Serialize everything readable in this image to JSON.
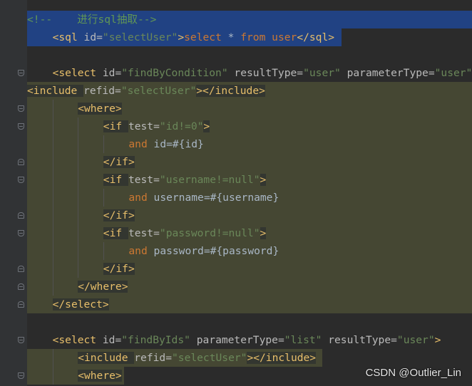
{
  "editor": {
    "lines": [
      {
        "tokens": [
          {
            "t": "<!--    进行sql抽取-->",
            "c": "com"
          }
        ]
      },
      {
        "tokens": [
          {
            "t": "<sql ",
            "c": "tag"
          },
          {
            "t": "id",
            "c": "attr"
          },
          {
            "t": "=",
            "c": "attr"
          },
          {
            "t": "\"selectUser\"",
            "c": "val"
          },
          {
            "t": ">",
            "c": "tag"
          },
          {
            "t": "select",
            "c": "kw"
          },
          {
            "t": " * ",
            "c": "txt"
          },
          {
            "t": "from",
            "c": "kw"
          },
          {
            "t": " ",
            "c": "txt"
          },
          {
            "t": "user",
            "c": "kw"
          },
          {
            "t": "</sql>",
            "c": "tag"
          }
        ]
      },
      {
        "tokens": []
      },
      {
        "tokens": [
          {
            "t": "<select ",
            "c": "tag"
          },
          {
            "t": "id",
            "c": "attr"
          },
          {
            "t": "=",
            "c": "attr"
          },
          {
            "t": "\"findByCondition\"",
            "c": "val"
          },
          {
            "t": " resultType",
            "c": "attr"
          },
          {
            "t": "=",
            "c": "attr"
          },
          {
            "t": "\"user\"",
            "c": "val"
          },
          {
            "t": " parameterType",
            "c": "attr"
          },
          {
            "t": "=",
            "c": "attr"
          },
          {
            "t": "\"user\"",
            "c": "val"
          }
        ]
      },
      {
        "tokens": [
          {
            "t": "<include ",
            "c": "tag"
          },
          {
            "t": "refid",
            "c": "attr"
          },
          {
            "t": "=",
            "c": "attr"
          },
          {
            "t": "\"selectUser\"",
            "c": "val"
          },
          {
            "t": "></include>",
            "c": "tag"
          }
        ]
      },
      {
        "tokens": [
          {
            "t": "<where>",
            "c": "tag"
          }
        ]
      },
      {
        "tokens": [
          {
            "t": "<if ",
            "c": "tag"
          },
          {
            "t": "test",
            "c": "attr"
          },
          {
            "t": "=",
            "c": "attr"
          },
          {
            "t": "\"id!=0\"",
            "c": "val"
          },
          {
            "t": ">",
            "c": "tag"
          }
        ]
      },
      {
        "tokens": [
          {
            "t": "and",
            "c": "kw"
          },
          {
            "t": " id=#{id}",
            "c": "txt"
          }
        ]
      },
      {
        "tokens": [
          {
            "t": "</if>",
            "c": "tag"
          }
        ]
      },
      {
        "tokens": [
          {
            "t": "<if ",
            "c": "tag"
          },
          {
            "t": "test",
            "c": "attr"
          },
          {
            "t": "=",
            "c": "attr"
          },
          {
            "t": "\"username!=null\"",
            "c": "val"
          },
          {
            "t": ">",
            "c": "tag"
          }
        ]
      },
      {
        "tokens": [
          {
            "t": "and",
            "c": "kw"
          },
          {
            "t": " username=#{username}",
            "c": "txt"
          }
        ]
      },
      {
        "tokens": [
          {
            "t": "</if>",
            "c": "tag"
          }
        ]
      },
      {
        "tokens": [
          {
            "t": "<if ",
            "c": "tag"
          },
          {
            "t": "test",
            "c": "attr"
          },
          {
            "t": "=",
            "c": "attr"
          },
          {
            "t": "\"password!=null\"",
            "c": "val"
          },
          {
            "t": ">",
            "c": "tag"
          }
        ]
      },
      {
        "tokens": [
          {
            "t": "and",
            "c": "kw"
          },
          {
            "t": " password=#{password}",
            "c": "txt"
          }
        ]
      },
      {
        "tokens": [
          {
            "t": "</if>",
            "c": "tag"
          }
        ]
      },
      {
        "tokens": [
          {
            "t": "</where>",
            "c": "tag"
          }
        ]
      },
      {
        "tokens": [
          {
            "t": "</select>",
            "c": "tag"
          }
        ]
      },
      {
        "tokens": []
      },
      {
        "tokens": [
          {
            "t": "<select ",
            "c": "tag"
          },
          {
            "t": "id",
            "c": "attr"
          },
          {
            "t": "=",
            "c": "attr"
          },
          {
            "t": "\"findByIds\"",
            "c": "val"
          },
          {
            "t": " parameterType",
            "c": "attr"
          },
          {
            "t": "=",
            "c": "attr"
          },
          {
            "t": "\"list\"",
            "c": "val"
          },
          {
            "t": " resultType",
            "c": "attr"
          },
          {
            "t": "=",
            "c": "attr"
          },
          {
            "t": "\"user\"",
            "c": "val"
          },
          {
            "t": ">",
            "c": "tag"
          }
        ]
      },
      {
        "tokens": [
          {
            "t": "<include ",
            "c": "tag"
          },
          {
            "t": "refid",
            "c": "attr"
          },
          {
            "t": "=",
            "c": "attr"
          },
          {
            "t": "\"selectUser\"",
            "c": "val"
          },
          {
            "t": "></include>",
            "c": "tag"
          }
        ]
      },
      {
        "tokens": [
          {
            "t": "<where>",
            "c": "tag"
          }
        ]
      }
    ]
  },
  "watermark": "CSDN @Outlier_Lin",
  "colors": {
    "background": "#2b2b2b",
    "gutter": "#313335",
    "selection_blue": "#214283",
    "selection_olive": "#454733",
    "tag": "#e8bf6a",
    "attribute": "#bababa",
    "string": "#6a8759",
    "keyword": "#cc7832",
    "text": "#a9b7c6",
    "comment": "#629755"
  }
}
